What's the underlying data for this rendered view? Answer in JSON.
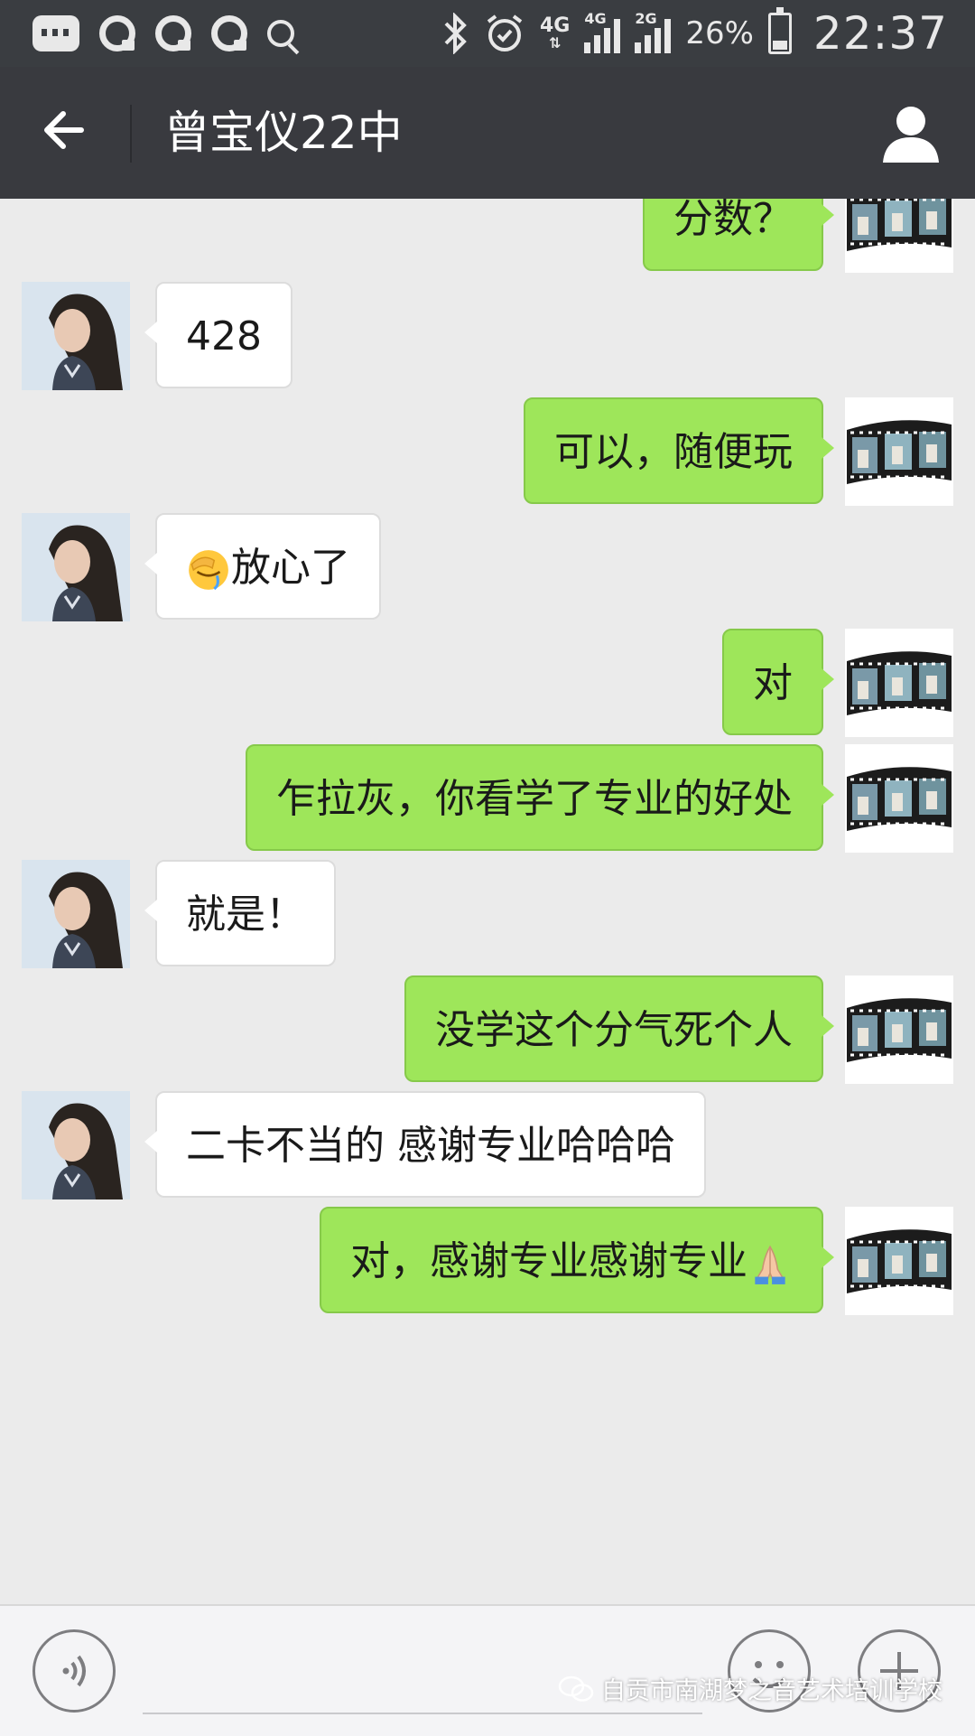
{
  "status_bar": {
    "network_primary": "4G",
    "signal_1_label": "4G",
    "signal_2_label": "2G",
    "battery_percent": "26%",
    "time": "22:37",
    "icons": [
      "message-icon",
      "qq-icon",
      "qq-icon",
      "qq-icon",
      "search-icon",
      "bluetooth-icon",
      "alarm-icon",
      "signal-icon",
      "battery-icon"
    ]
  },
  "header": {
    "title": "曾宝仪22中",
    "back_icon": "arrow-left-icon",
    "profile_icon": "person-icon"
  },
  "messages": [
    {
      "sender": "me",
      "text": "分数？"
    },
    {
      "sender": "them",
      "text": "428"
    },
    {
      "sender": "me",
      "text": "可以，随便玩"
    },
    {
      "sender": "them",
      "emoji": "facepalm-emoji",
      "text": "放心了"
    },
    {
      "sender": "me",
      "text": "对"
    },
    {
      "sender": "me",
      "text": "乍拉灰，你看学了专业的好处"
    },
    {
      "sender": "them",
      "text": "就是！"
    },
    {
      "sender": "me",
      "text": "没学这个分气死个人"
    },
    {
      "sender": "them",
      "text": "二卡不当的 感谢专业哈哈哈"
    },
    {
      "sender": "me",
      "text": "对，感谢专业感谢专业",
      "emoji_after": "folded-hands-emoji"
    }
  ],
  "input_bar": {
    "voice_icon": "voice-icon",
    "emoji_icon": "emoji-icon",
    "plus_icon": "plus-icon"
  },
  "watermark": "自贡市南湖梦之音艺术培训学校",
  "colors": {
    "status_bar_bg": "#3a3d41",
    "title_bar_bg": "#393a3f",
    "chat_bg": "#ebebeb",
    "my_bubble": "#9ee65a",
    "their_bubble": "#ffffff"
  }
}
